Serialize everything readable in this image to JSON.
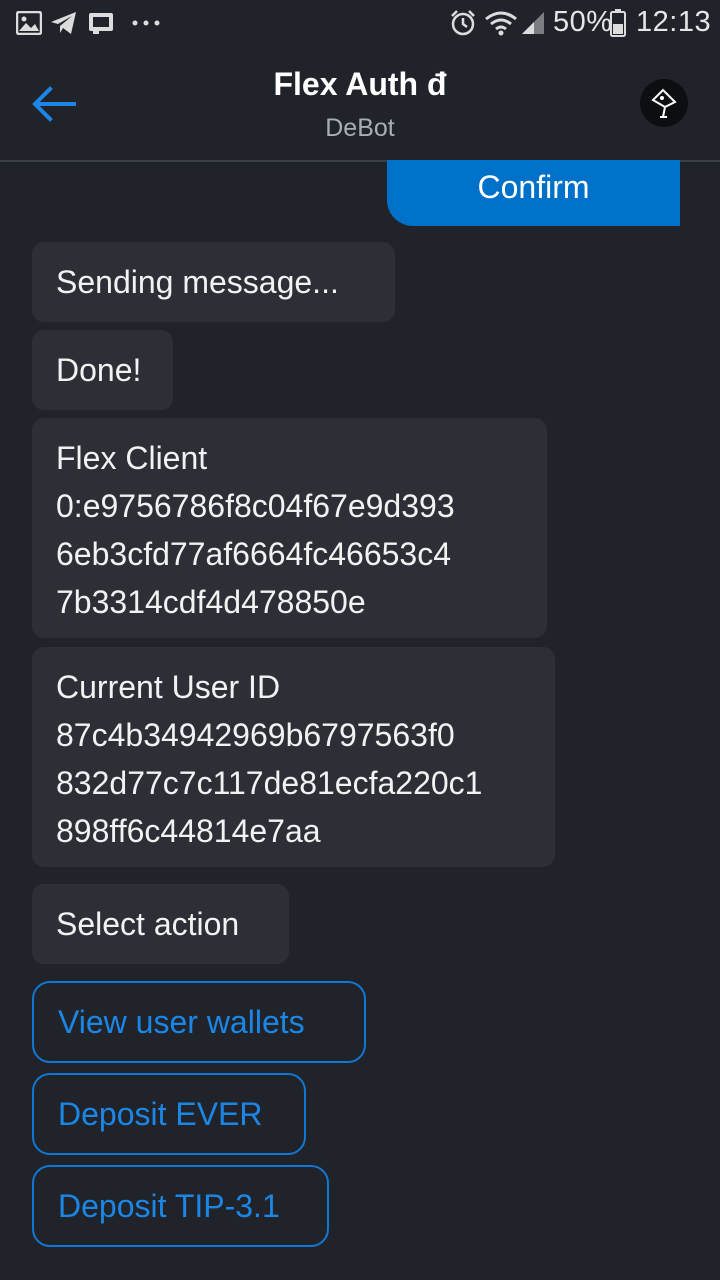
{
  "status_bar": {
    "battery": "50%",
    "time": "12:13",
    "icons": [
      "image-icon",
      "telegram-icon",
      "cast-icon",
      "more-dots-icon",
      "alarm-icon",
      "wifi-icon",
      "signal-icon",
      "battery-icon"
    ]
  },
  "header": {
    "title": "Flex Auth đ",
    "subtitle": "DeBot",
    "back_icon": "back-arrow-icon",
    "avatar_icon": "debot-avatar-icon"
  },
  "messages": {
    "user_confirm": "Confirm",
    "sending": "Sending message...",
    "done": "Done!",
    "flex_client": {
      "label": "Flex Client",
      "lines": [
        "0:e9756786f8c04f67e9d393",
        "6eb3cfd77af6664fc46653c4",
        "7b3314cdf4d478850e"
      ]
    },
    "current_user": {
      "label": "Current User ID",
      "lines": [
        "87c4b34942969b6797563f0",
        "832d77c7c117de81ecfa220c1",
        "898ff6c44814e7aa"
      ]
    },
    "select_action": "Select action"
  },
  "actions": [
    {
      "label": "View user wallets"
    },
    {
      "label": "Deposit EVER"
    },
    {
      "label": "Deposit TIP-3.1"
    }
  ],
  "colors": {
    "background": "#20242a",
    "bubble": "#2c3036",
    "accent": "#0071c8",
    "link": "#1b86e6"
  }
}
